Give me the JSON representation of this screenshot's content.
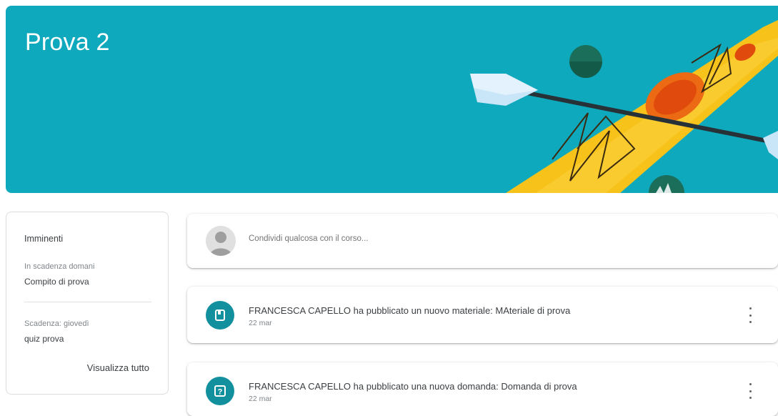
{
  "course": {
    "title": "Prova 2"
  },
  "upcoming": {
    "title": "Imminenti",
    "items": [
      {
        "due": "In scadenza domani",
        "name": "Compito di prova"
      },
      {
        "due": "Scadenza: giovedì",
        "name": "quiz prova"
      }
    ],
    "view_all": "Visualizza tutto"
  },
  "share": {
    "placeholder": "Condividi qualcosa con il corso..."
  },
  "posts": [
    {
      "text": "FRANCESCA CAPELLO ha pubblicato un nuovo materiale: MAteriale di prova",
      "date": "22 mar",
      "icon": "material-icon"
    },
    {
      "text": "FRANCESCA CAPELLO ha pubblicato una nuova domanda: Domanda di prova",
      "date": "22 mar",
      "icon": "question-icon"
    }
  ],
  "colors": {
    "banner": "#0fa9bd",
    "accent": "#12909e",
    "kayak": "#f9c21b",
    "kayak_center": "#e8540f",
    "paddle": "#cfe7f7"
  }
}
